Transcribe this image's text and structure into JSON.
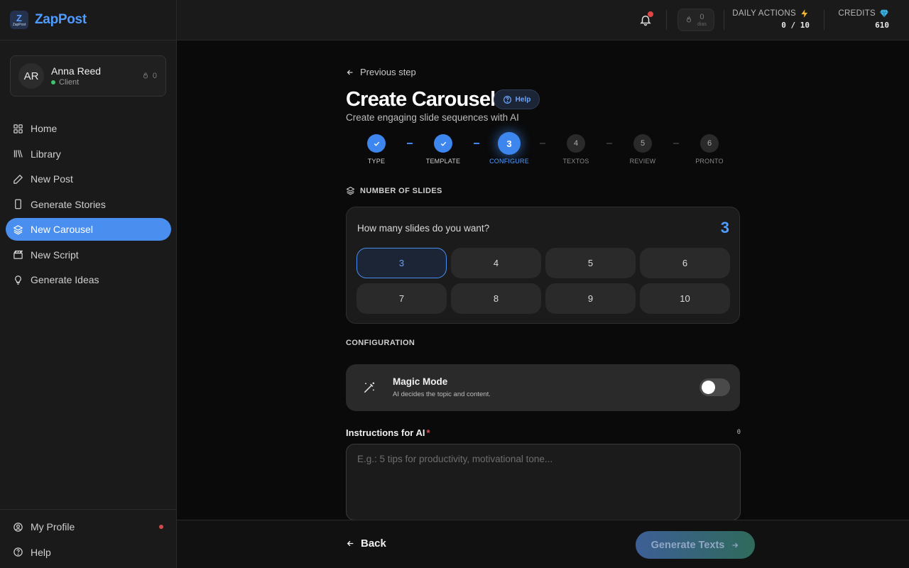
{
  "brand": {
    "name": "ZapPost",
    "logo_letter": "Z",
    "logo_sub": "ZapPost"
  },
  "user": {
    "initials": "AR",
    "name": "Anna Reed",
    "role": "Client",
    "streak": "0"
  },
  "sidebar": {
    "items": [
      {
        "label": "Home",
        "icon": "grid-icon"
      },
      {
        "label": "Library",
        "icon": "library-icon"
      },
      {
        "label": "New Post",
        "icon": "pencil-icon"
      },
      {
        "label": "Generate Stories",
        "icon": "phone-icon"
      },
      {
        "label": "New Carousel",
        "icon": "layers-icon",
        "active": true
      },
      {
        "label": "New Script",
        "icon": "clapperboard-icon"
      },
      {
        "label": "Generate Ideas",
        "icon": "lightbulb-icon"
      }
    ],
    "bottom": [
      {
        "label": "My Profile",
        "icon": "user-circle-icon",
        "notification": true
      },
      {
        "label": "Help",
        "icon": "help-circle-icon"
      }
    ]
  },
  "topbar": {
    "streak_count": "0",
    "streak_unit": "dias",
    "daily_actions_label": "DAILY ACTIONS",
    "daily_actions_value": "0 / 10",
    "credits_label": "CREDITS",
    "credits_value": "610"
  },
  "page": {
    "previous_step": "Previous step",
    "title": "Create Carousel",
    "help_label": "Help",
    "subtitle": "Create engaging slide sequences with AI"
  },
  "steps": [
    {
      "number": "1",
      "label": "TYPE",
      "state": "done"
    },
    {
      "number": "2",
      "label": "TEMPLATE",
      "state": "done"
    },
    {
      "number": "3",
      "label": "CONFIGURE",
      "state": "current"
    },
    {
      "number": "4",
      "label": "TEXTOS",
      "state": "pending"
    },
    {
      "number": "5",
      "label": "REVIEW",
      "state": "pending"
    },
    {
      "number": "6",
      "label": "PRONTO",
      "state": "pending"
    }
  ],
  "slides": {
    "section_label": "NUMBER OF SLIDES",
    "question": "How many slides do you want?",
    "selected": "3",
    "options": [
      "3",
      "4",
      "5",
      "6",
      "7",
      "8",
      "9",
      "10"
    ]
  },
  "configuration": {
    "section_label": "CONFIGURATION",
    "magic_title": "Magic Mode",
    "magic_subtitle": "AI decides the topic and content.",
    "magic_enabled": false
  },
  "instructions": {
    "label": "Instructions for AI",
    "required_mark": "*",
    "char_count": "0",
    "placeholder": "E.g.: 5 tips for productivity, motivational tone...",
    "value": ""
  },
  "footer": {
    "back_label": "Back",
    "generate_label": "Generate Texts"
  },
  "colors": {
    "accent": "#4a8ff0",
    "background": "#0a0a0a",
    "sidebar": "#1a1a1a",
    "danger": "#e04545",
    "online": "#3ec46d"
  }
}
